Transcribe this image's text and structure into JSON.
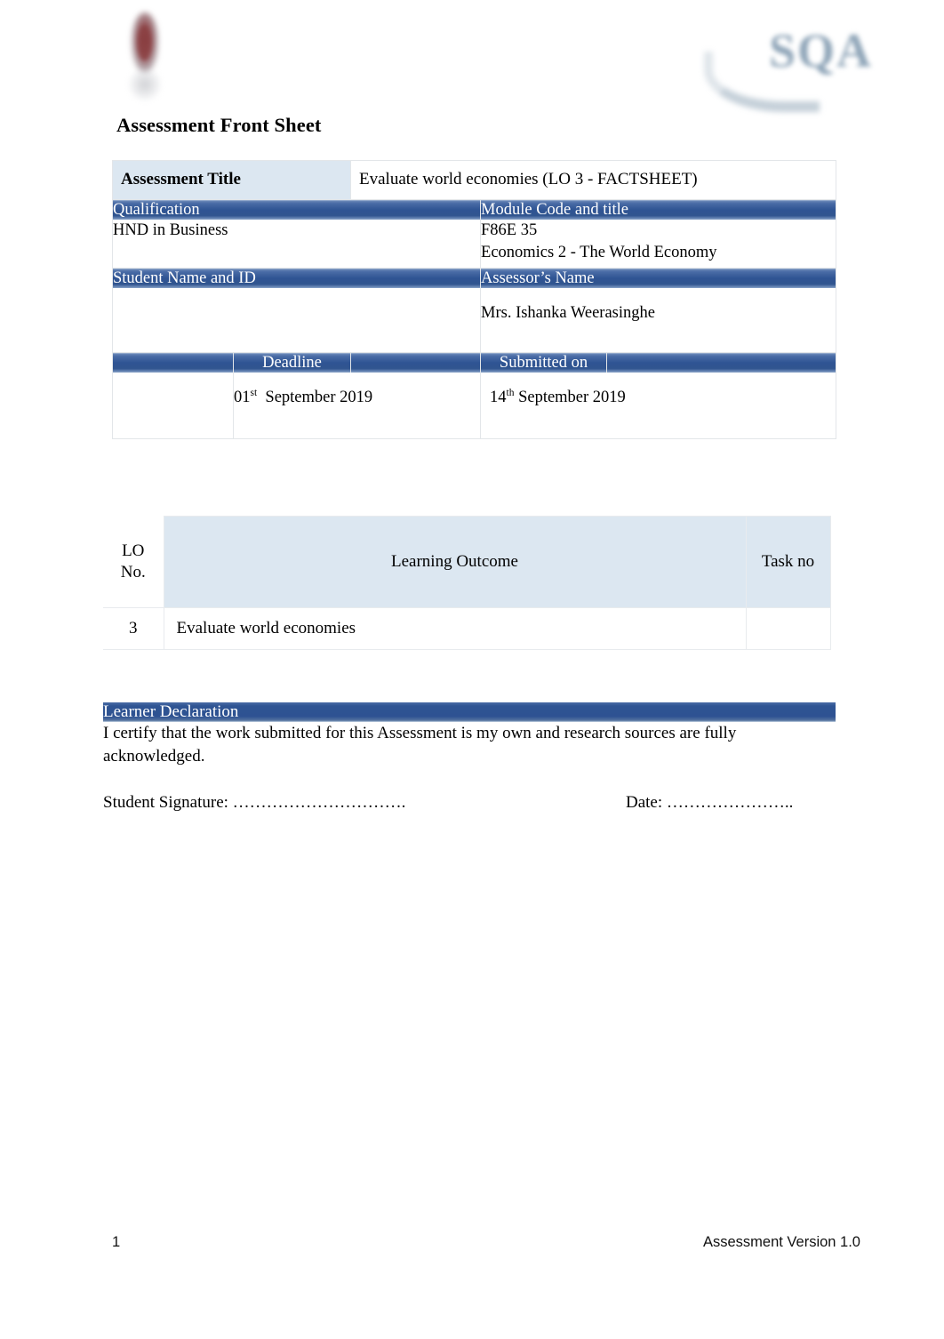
{
  "document": {
    "page_title": "Assessment Front Sheet",
    "left_logo_name": "institution-crest-logo",
    "right_logo_text": "SQA"
  },
  "details": {
    "assessment_title_label": "Assessment Title",
    "assessment_title_value": "Evaluate world economies (LO 3 - FACTSHEET)",
    "qualification_label": "Qualification",
    "qualification_value": "HND in Business",
    "module_label": "Module Code and title",
    "module_code": "F86E 35",
    "module_title": "Economics 2 - The World Economy",
    "student_label": "Student Name and ID",
    "student_value": "",
    "assessor_label": "Assessor’s Name",
    "assessor_value": "Mrs. Ishanka Weerasinghe",
    "deadline_label": "Deadline",
    "deadline_day": "01",
    "deadline_ordinal": "st",
    "deadline_rest": "September 2019",
    "submitted_label": "Submitted on",
    "submitted_day": "14",
    "submitted_ordinal": "th",
    "submitted_rest": "September 2019"
  },
  "learning_outcomes": {
    "headers": {
      "lo_no_line1": "LO",
      "lo_no_line2": "No.",
      "outcome": "Learning Outcome",
      "task_no": "Task no"
    },
    "rows": [
      {
        "lo_no": "3",
        "outcome": "Evaluate world economies",
        "task_no": ""
      }
    ]
  },
  "declaration": {
    "heading": "Learner Declaration",
    "body": "I certify that the work submitted for this Assessment is my own and research sources are fully acknowledged.",
    "signature_label": "Student Signature: ………………………….",
    "date_label": "Date: ………………….."
  },
  "footer": {
    "page_number": "1",
    "version": "Assessment Version 1.0"
  },
  "colors": {
    "header_blue": "#2f5493",
    "light_blue": "#dce7f1",
    "border_gray": "#e3e6e9"
  }
}
